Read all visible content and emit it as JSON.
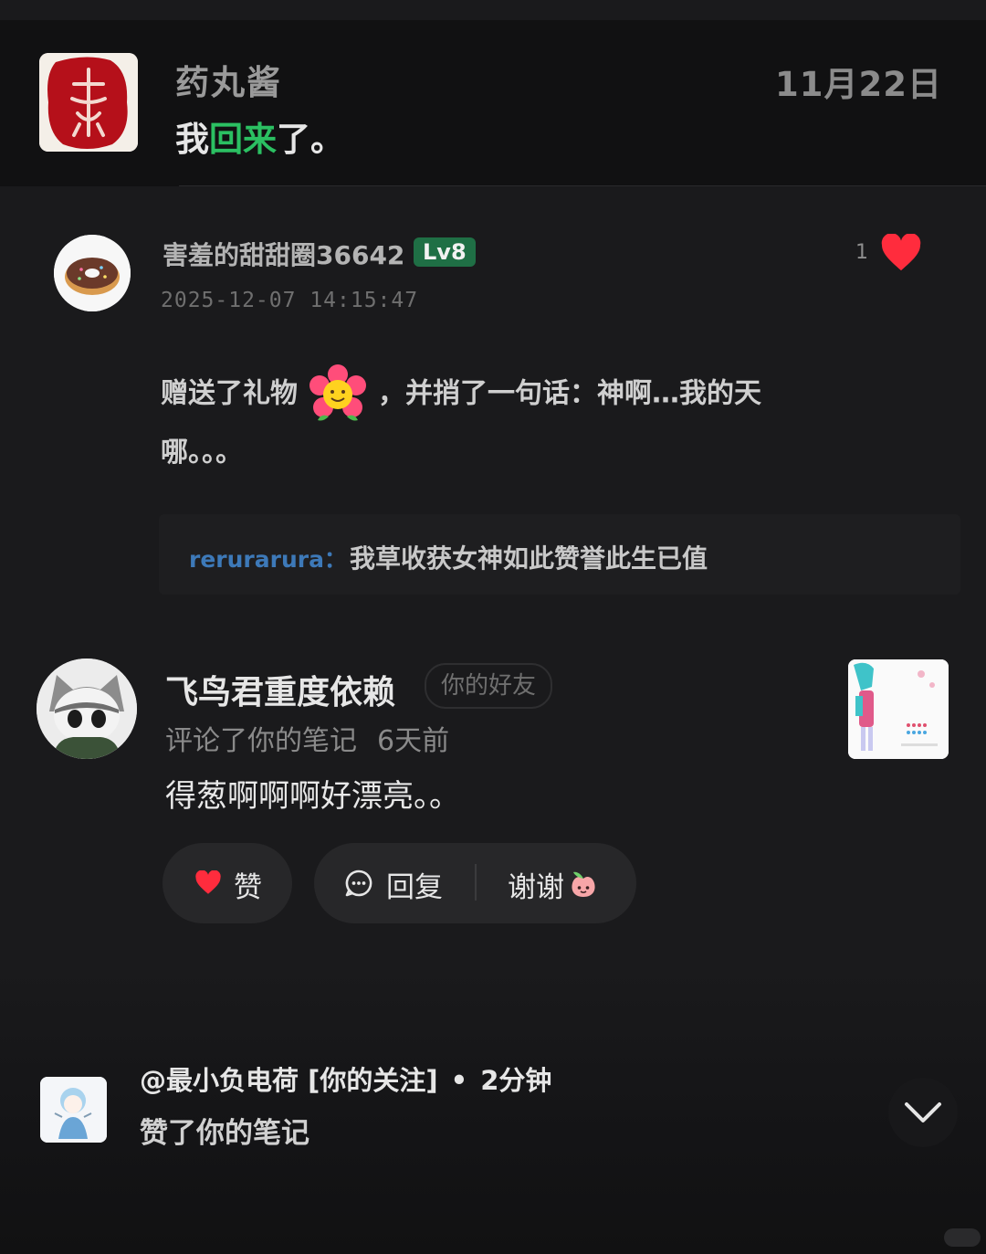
{
  "header_card": {
    "name": "药丸酱",
    "date": "11月22日",
    "message_prefix": "我",
    "message_highlight": "回来",
    "message_suffix": "了。"
  },
  "gift_comment": {
    "username": "害羞的甜甜圈36642",
    "level": "Lv8",
    "like_count": "1",
    "timestamp": "2025-12-07 14:15:47",
    "text_before_gift": "赠送了礼物",
    "text_after_gift": "，并捎了一句话：神啊…我的天",
    "text_line2": "哪。。。",
    "quote_user": "rerurarura：",
    "quote_text": "我草收获女神如此赞誉此生已值"
  },
  "comment_notification": {
    "username": "飞鸟君重度依赖",
    "relation_badge": "你的好友",
    "action": "评论了你的笔记",
    "time_ago": "6天前",
    "comment_text": "得葱啊啊啊好漂亮。。",
    "like_button": "赞",
    "reply_button": "回复",
    "thanks_button": "谢谢"
  },
  "like_notification": {
    "username": "@最小负电荷",
    "tag": "[你的关注]",
    "separator": "•",
    "time_ago": "2分钟",
    "action": "赞了你的笔记"
  },
  "colors": {
    "accent_green": "#2bc062",
    "heart_red": "#ff2c3d",
    "level_badge": "#1f6f45",
    "quote_user_blue": "#3d79b8"
  },
  "icons": [
    "heart-icon",
    "comment-bubble-icon",
    "peach-icon",
    "flower-gift-icon",
    "chevron-down-icon"
  ]
}
